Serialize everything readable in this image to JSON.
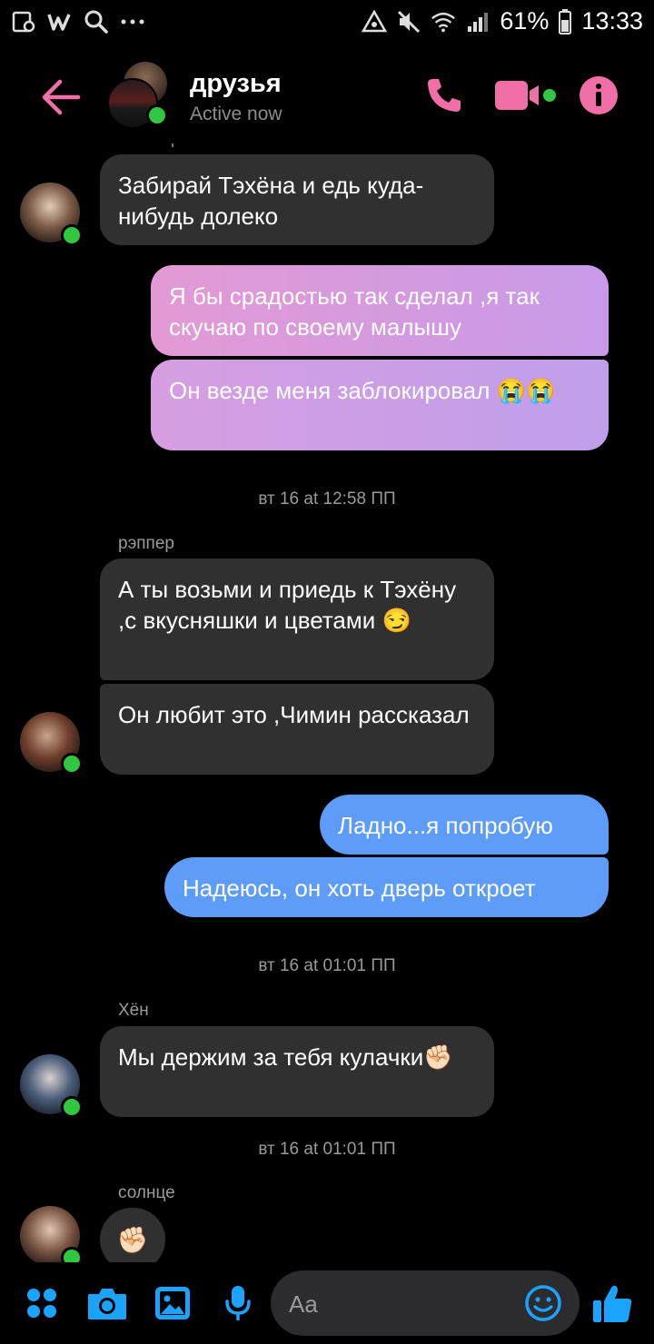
{
  "status_bar": {
    "battery": "61%",
    "time": "13:33",
    "left_icons": [
      "notification-icon",
      "w-app-icon",
      "search-icon",
      "more-icon"
    ],
    "right_icons": [
      "data-saver-icon",
      "mute-icon",
      "wifi-icon",
      "signal-icon",
      "battery-icon"
    ]
  },
  "header": {
    "title": "друзья",
    "subtitle": "Active now",
    "accent": "#f06fa6"
  },
  "messages": [
    {
      "side": "left",
      "text": "Забирай Тэхёна и едь куда-нибудь долеко"
    },
    {
      "side": "right",
      "style": "pink",
      "text": "Я бы срадостью так сделал ,я так скучаю по своему малышу"
    },
    {
      "side": "right",
      "style": "pink",
      "text": "Он везде меня заблокировал 😭😭"
    },
    {
      "type": "timestamp",
      "text": "вт 16 at 12:58 ПП"
    },
    {
      "type": "sender",
      "text": "рэппер"
    },
    {
      "side": "left",
      "text": "А ты возьми и приедь к Тэхёну ,с вкусняшки и цветами 😏"
    },
    {
      "side": "left",
      "text": "Он любит это ,Чимин рассказал"
    },
    {
      "side": "right",
      "style": "blue",
      "text": "Ладно...я попробую"
    },
    {
      "side": "right",
      "style": "blue",
      "text": "Надеюсь, он хоть дверь откроет"
    },
    {
      "type": "timestamp",
      "text": "вт 16 at 01:01 ПП"
    },
    {
      "type": "sender",
      "text": "Хён"
    },
    {
      "side": "left",
      "text": "Мы держим за тебя кулачки✊🏻"
    },
    {
      "type": "timestamp",
      "text": "вт 16 at 01:01 ПП"
    },
    {
      "type": "sender",
      "text": "солнце"
    },
    {
      "side": "left",
      "text": "✊🏻"
    }
  ],
  "composer": {
    "placeholder": "Aa"
  },
  "colors": {
    "received_bubble": "#303030",
    "pink_start": "#e39ad4",
    "pink_end": "#c79ae8",
    "blue_bubble": "#5d9cf9",
    "online": "#31c740",
    "toolbar_blue": "#1aa3ff"
  }
}
